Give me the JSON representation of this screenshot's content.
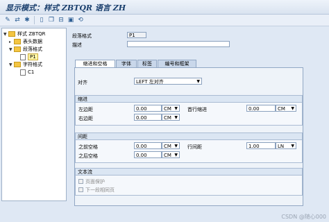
{
  "window": {
    "title": "显示模式：样式 ZBTQR 语言 ZH"
  },
  "toolbar": {
    "icons": [
      "edit-icon",
      "toggle-icon",
      "activate-icon",
      "new-icon",
      "copy-icon",
      "delete-icon",
      "save-icon",
      "refresh-icon"
    ]
  },
  "tree": {
    "root": "样式 ZBTQR",
    "header": "表头数据",
    "paragraph_folder": "段落格式",
    "p1": "P1",
    "char_folder": "字符格式",
    "c1": "C1"
  },
  "form": {
    "paragraph_label": "段落格式",
    "paragraph_value": "P1",
    "desc_label": "描述",
    "desc_value": ""
  },
  "tabs": [
    "缩进和空格",
    "字体",
    "标签",
    "编号和框架"
  ],
  "align": {
    "label": "对齐",
    "value": "LEFT 左对齐"
  },
  "indent": {
    "title": "缩进",
    "left_label": "左边距",
    "left_value": "0.00",
    "left_unit": "CM",
    "right_label": "右边距",
    "right_value": "0.00",
    "right_unit": "CM",
    "first_label": "首行缩进",
    "first_value": "0.00",
    "first_unit": "CM"
  },
  "spacing": {
    "title": "间距",
    "before_label": "之前空格",
    "before_value": "0.00",
    "before_unit": "CM",
    "after_label": "之后空格",
    "after_value": "0.00",
    "after_unit": "CM",
    "line_label": "行间距",
    "line_value": "1.00",
    "line_unit": "LN"
  },
  "textflow": {
    "title": "文本流",
    "page_protect": "页面保护",
    "next_same_page": "下一段相同页"
  },
  "watermark": "CSDN @随心000"
}
